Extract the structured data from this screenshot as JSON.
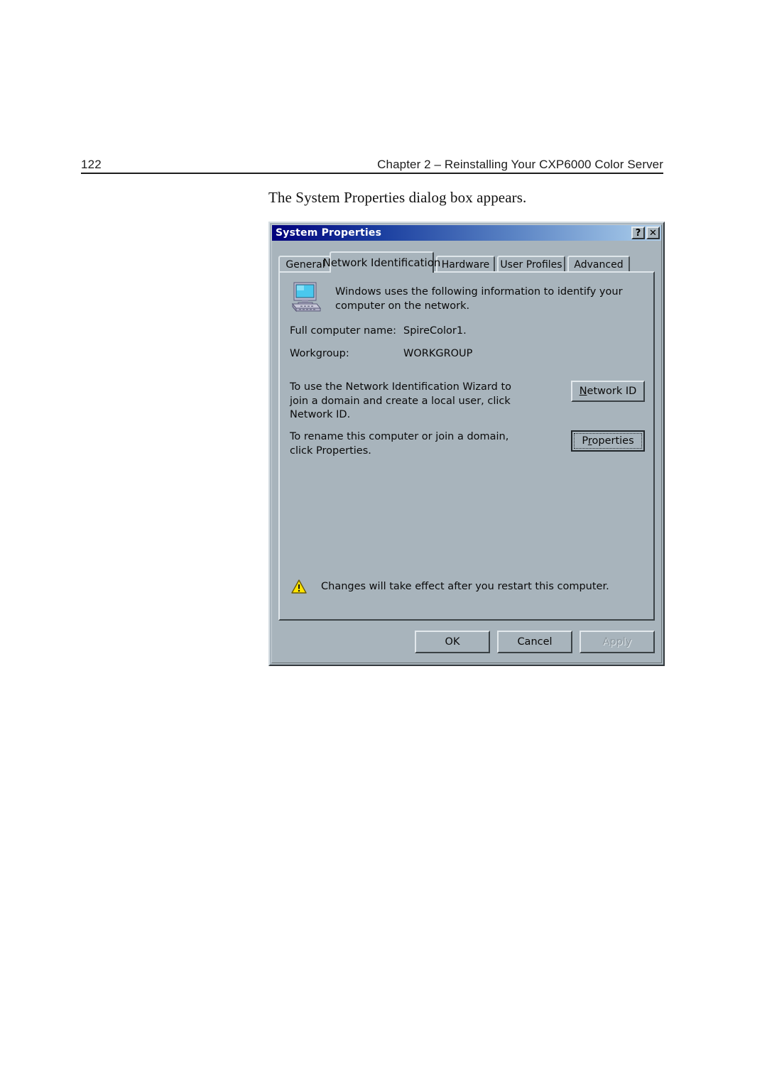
{
  "page": {
    "number": "122",
    "header_title": "Chapter 2 – Reinstalling Your CXP6000 Color Server",
    "caption": "The System Properties dialog box appears."
  },
  "dialog": {
    "title": "System Properties",
    "titlebar_buttons": [
      {
        "name": "help-button",
        "glyph": "?"
      },
      {
        "name": "close-button",
        "glyph": "✕"
      }
    ],
    "tabs": [
      {
        "label": "General",
        "selected": false
      },
      {
        "label": "Network Identification",
        "selected": true
      },
      {
        "label": "Hardware",
        "selected": false
      },
      {
        "label": "User Profiles",
        "selected": false
      },
      {
        "label": "Advanced",
        "selected": false
      }
    ],
    "intro_text": "Windows uses the following information to identify your computer on the network.",
    "fields": [
      {
        "label": "Full computer name:",
        "value": "SpireColor1."
      },
      {
        "label": "Workgroup:",
        "value": "WORKGROUP"
      }
    ],
    "actions": [
      {
        "text": "To use the Network Identification Wizard to join a domain and create a local user, click Network ID.",
        "button_pre": "N",
        "button_post": "etwork ID",
        "button_label": "Network ID",
        "focused": false
      },
      {
        "text": "To rename this computer or join a domain, click Properties.",
        "button_pre": "P",
        "button_mn": "r",
        "button_post": "operties",
        "button_label": "Properties",
        "focused": true
      }
    ],
    "warning": "Changes will take effect after you restart this computer.",
    "footer_buttons": [
      {
        "label": "OK",
        "disabled": false
      },
      {
        "label": "Cancel",
        "disabled": false
      },
      {
        "label": "Apply",
        "disabled": true
      }
    ],
    "colors": {
      "face": "#a8b4bc",
      "titlebar_start": "#00007c",
      "titlebar_end": "#adcce9",
      "warning_yellow": "#ffe400",
      "screen_cyan": "#49c8ee"
    }
  }
}
